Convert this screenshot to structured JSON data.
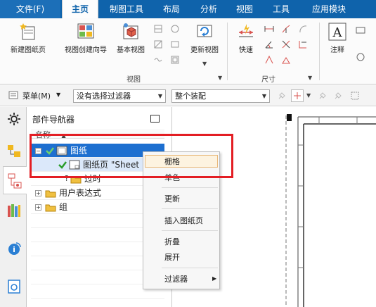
{
  "menubar": {
    "tabs": [
      {
        "label": "文件(F)"
      },
      {
        "label": "主页"
      },
      {
        "label": "制图工具"
      },
      {
        "label": "布局"
      },
      {
        "label": "分析"
      },
      {
        "label": "视图"
      },
      {
        "label": "工具"
      },
      {
        "label": "应用模块"
      }
    ],
    "active_index": 1
  },
  "ribbon": {
    "buttons": [
      {
        "label": "新建图纸页"
      },
      {
        "label": "视图创建向导"
      },
      {
        "label": "基本视图"
      },
      {
        "label": "更新视图"
      },
      {
        "label": "快速"
      },
      {
        "label": "注释"
      }
    ],
    "groups": [
      {
        "label": "视图"
      },
      {
        "label": "尺寸"
      }
    ]
  },
  "toolbar": {
    "menu_label": "菜单(M)",
    "filter_value": "没有选择过滤器",
    "assembly_value": "整个装配"
  },
  "navigator": {
    "title": "部件导航器",
    "column_header": "名称",
    "tree": [
      {
        "label": "图纸"
      },
      {
        "label": "图纸页 \"Sheet 1"
      },
      {
        "label": "过时"
      },
      {
        "label": "用户表达式"
      },
      {
        "label": "组"
      }
    ]
  },
  "context_menu": {
    "items": [
      {
        "label": "栅格"
      },
      {
        "label": "单色"
      },
      {
        "label": "更新"
      },
      {
        "label": "插入图纸页"
      },
      {
        "label": "折叠"
      },
      {
        "label": "展开"
      },
      {
        "label": "过滤器"
      }
    ]
  },
  "colors": {
    "menubar_bg": "#0f63ab",
    "selection": "#1d6fd0",
    "highlight_box": "#e31e24",
    "check_green": "#2a9d2a"
  }
}
